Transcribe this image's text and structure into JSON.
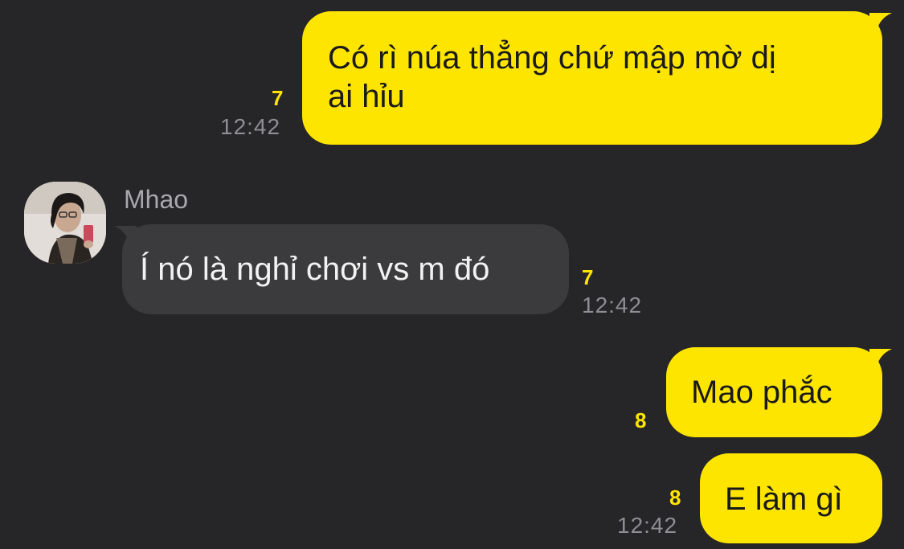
{
  "theme": {
    "background": "#262527",
    "outgoing_bubble": "#FEE500",
    "incoming_bubble": "#3b3b3d",
    "unread_color": "#FEE500",
    "time_color": "#8e8e93"
  },
  "messages": [
    {
      "direction": "outgoing",
      "lines": [
        "Có rì núa thẳng chứ mập mờ dị",
        "ai hỉu"
      ],
      "unread_count": "7",
      "time": "12:42"
    },
    {
      "direction": "incoming",
      "sender": "Mhao",
      "avatar_icon": "profile-photo",
      "text": "Í nó là nghỉ chơi vs m đó",
      "unread_count": "7",
      "time": "12:42"
    },
    {
      "direction": "outgoing",
      "text": "Mao phắc",
      "unread_count": "8"
    },
    {
      "direction": "outgoing",
      "text": "E làm gì",
      "unread_count": "8",
      "time": "12:42"
    }
  ]
}
